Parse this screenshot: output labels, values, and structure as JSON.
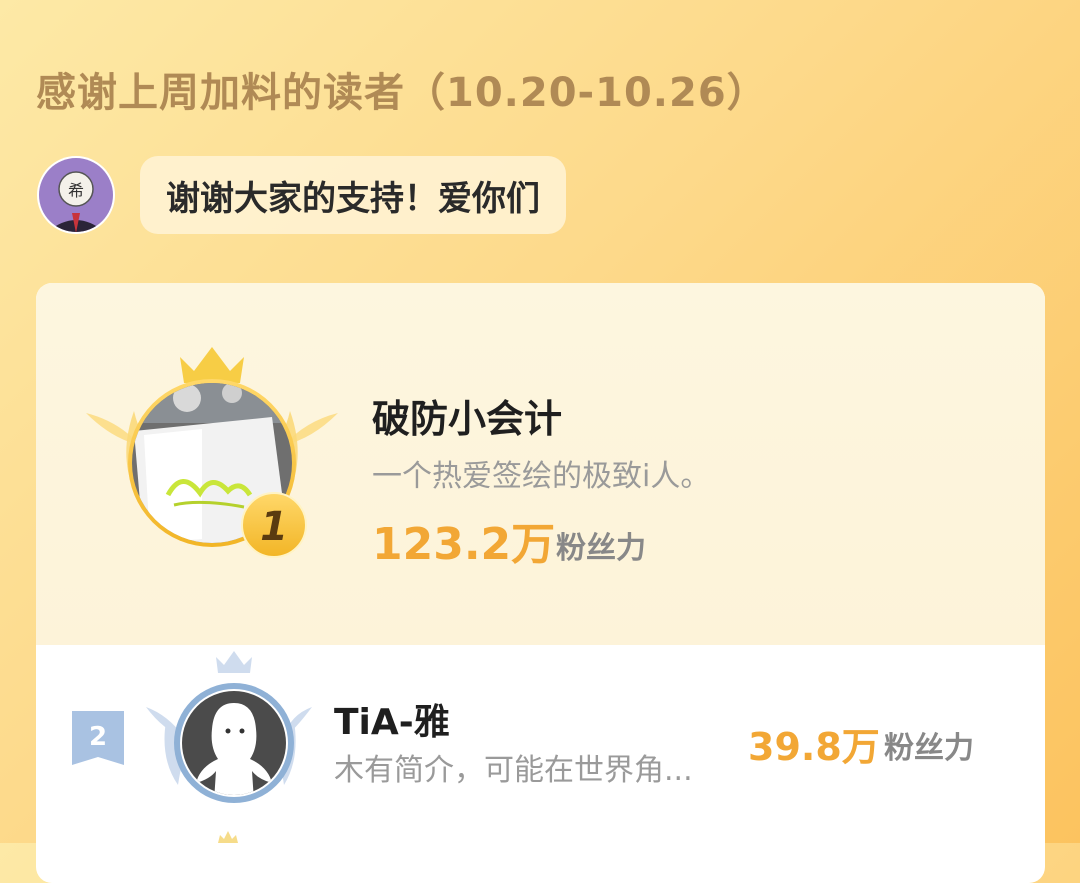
{
  "header": {
    "title": "感谢上周加料的读者（10.20-10.26）"
  },
  "author": {
    "avatar_icon": "author-avatar-icon",
    "avatar_glyph": "希",
    "message": "谢谢大家的支持！爱你们"
  },
  "leaderboard": {
    "first": {
      "rank": "1",
      "name": "破防小会计",
      "bio": "一个热爱签绘的极致i人。",
      "value": "123.2万",
      "unit": "粉丝力"
    },
    "second": {
      "rank": "2",
      "name": "TiA-雅",
      "bio": "木有简介，可能在世界角...",
      "value": "39.8万",
      "unit": "粉丝力"
    }
  },
  "colors": {
    "accent": "#f2a735",
    "title": "#b08a55",
    "gold": "#f5c53a",
    "silver": "#8fb1d6"
  }
}
